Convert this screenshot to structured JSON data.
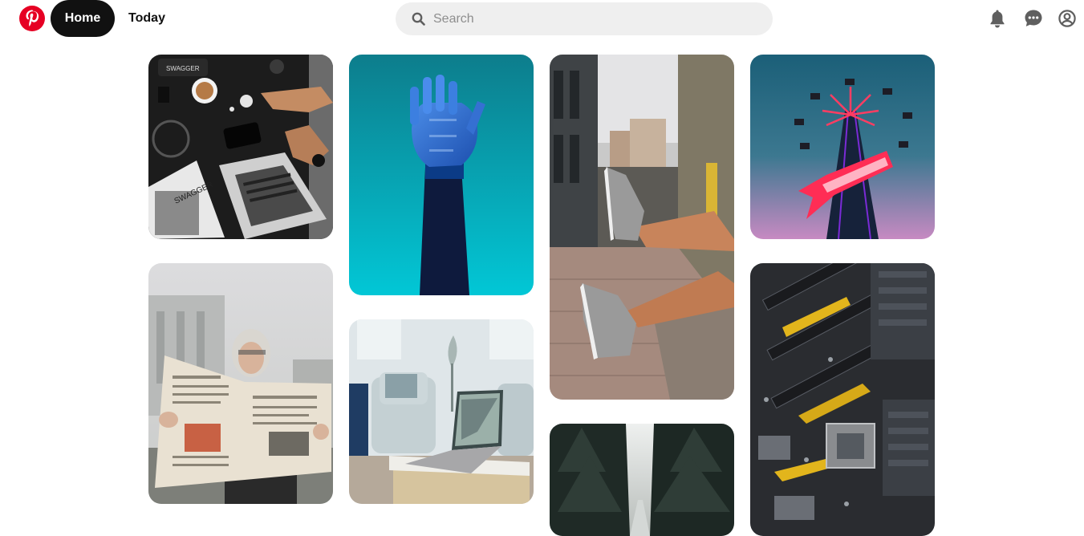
{
  "header": {
    "home_label": "Home",
    "today_label": "Today",
    "search_placeholder": "Search",
    "logo_icon": "pinterest-logo-icon",
    "icons": [
      "notifications-bell-icon",
      "messages-icon",
      "profile-icon"
    ]
  },
  "colors": {
    "brand": "#e60023",
    "active_nav": "#111111",
    "search_bg": "#efefef"
  },
  "pins": [
    {
      "id": "desk-flatlay",
      "alt": "Workspace flatlay with laptop, coffee and Swagger magazine"
    },
    {
      "id": "robot-hand",
      "alt": "Blue robotic hand on teal background"
    },
    {
      "id": "sneakers-street",
      "alt": "Legs in grey sneakers over a sidewalk curb"
    },
    {
      "id": "neon-tower",
      "alt": "Neon star swing ride tower at dusk"
    },
    {
      "id": "newspaper-woman",
      "alt": "Woman reading a newspaper outdoors"
    },
    {
      "id": "laptop-livingroom",
      "alt": "Laptop on a marble table in a bright living room"
    },
    {
      "id": "motherboard",
      "alt": "Close-up of a computer motherboard"
    },
    {
      "id": "forest-road",
      "alt": "Foggy road through dark pine forest"
    }
  ]
}
